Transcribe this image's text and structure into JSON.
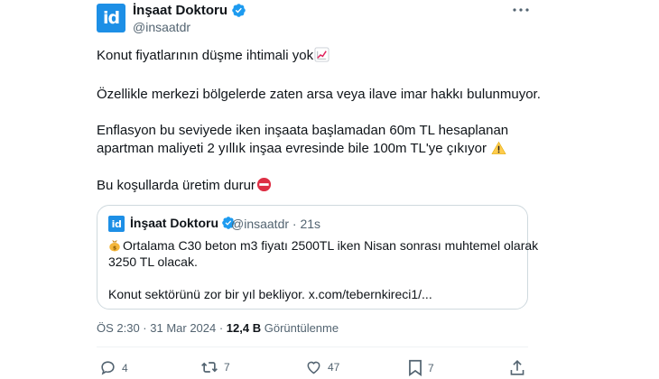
{
  "author": {
    "name": "İnşaat Doktoru",
    "handle": "@insaatdr",
    "avatar_text": "id",
    "verified_icon": "verified-badge-icon"
  },
  "tweet": {
    "line1": "Konut fiyatlarının düşme ihtimali yok",
    "line2": "Özellikle merkezi bölgelerde zaten arsa veya ilave imar hakkı bulunmuyor.",
    "line3": "Enflasyon bu seviyede iken inşaata başlamadan 60m TL hesaplanan",
    "line4": "apartman maliyeti 2 yıllık inşaa evresinde bile 100m TL'ye çıkıyor",
    "line5": "Bu koşullarda üretim durur",
    "emojis": [
      "chart-increasing-emoji",
      "warning-emoji",
      "no-entry-emoji"
    ]
  },
  "quote": {
    "avatar_text": "id",
    "name": "İnşaat Doktoru",
    "handle_time": "@insaatdr · 21s",
    "line1": "Ortalama C30 beton m3 fiyatı 2500TL iken Nisan sonrası muhtemel olarak",
    "line2": "3250 TL olacak.",
    "line3": "Konut sektörünü zor bir yıl bekliyor. x.com/tebernkireci1/..."
  },
  "meta": {
    "time": "ÖS 2:30 · 31 Mar 2024 · ",
    "views_count": "12,4 B",
    "views_label": " Görüntülenme"
  },
  "actions": {
    "replies": "4",
    "retweets": "7",
    "likes": "47",
    "bookmarks": "7"
  },
  "colors": {
    "accent": "#1d9bf0",
    "avatar_bg": "#1d8fe6",
    "text": "#0f1419",
    "muted": "#536471",
    "border": "#cfd9de"
  }
}
